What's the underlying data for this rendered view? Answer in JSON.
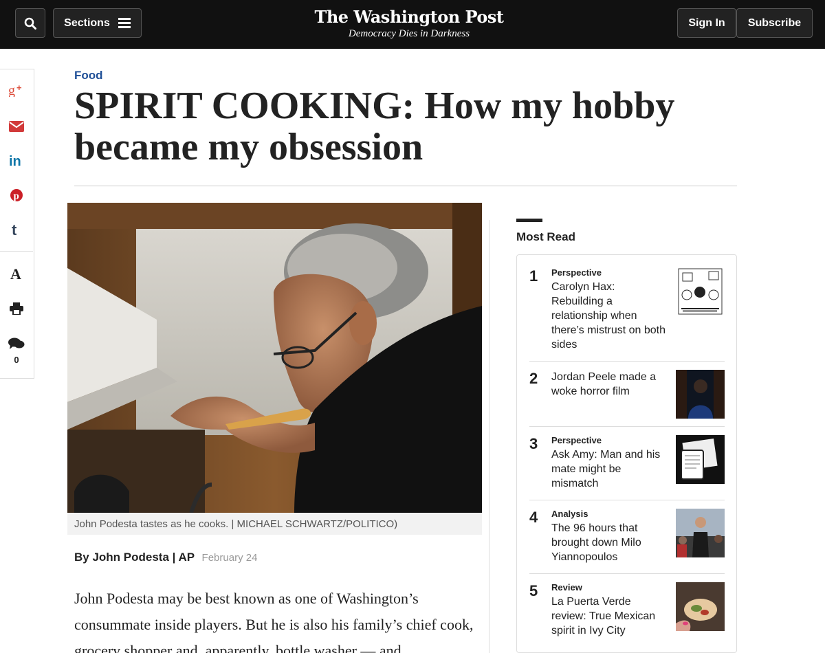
{
  "header": {
    "sections_label": "Sections",
    "logo_name": "The Washington Post",
    "logo_tagline": "Democracy Dies in Darkness",
    "signin_label": "Sign In",
    "subscribe_label": "Subscribe"
  },
  "share_rail": {
    "icons": [
      "google-plus-icon",
      "email-icon",
      "linkedin-icon",
      "pinterest-icon",
      "tumblr-icon",
      "text-size-icon",
      "print-icon",
      "comments-icon"
    ],
    "comment_count": "0",
    "colors": {
      "google_plus": "#dd4b39",
      "email": "#d23a3a",
      "linkedin": "#0e76a8",
      "pinterest": "#cb2027",
      "tumblr": "#35465c"
    }
  },
  "article": {
    "kicker": "Food",
    "headline": "SPIRIT COOKING: How my hobby became my obsession",
    "caption": "John Podesta tastes as he cooks. | MICHAEL SCHWARTZ/POLITICO)",
    "byline": "By John Podesta | AP",
    "date": "February 24",
    "body": "John Podesta may be best known as one of Washington’s consummate inside players. But he is also his family’s chief cook, grocery shopper and, apparently, bottle washer — and"
  },
  "most_read": {
    "title": "Most Read",
    "items": [
      {
        "num": "1",
        "label": "Perspective",
        "headline": "Carolyn Hax: Rebuilding a relationship when there’s mistrust on both sides"
      },
      {
        "num": "2",
        "label": "",
        "headline": "Jordan Peele made a woke horror film"
      },
      {
        "num": "3",
        "label": "Perspective",
        "headline": "Ask Amy: Man and his mate might be mismatch"
      },
      {
        "num": "4",
        "label": "Analysis",
        "headline": "The 96 hours that brought down Milo Yiannopoulos"
      },
      {
        "num": "5",
        "label": "Review",
        "headline": "La Puerta Verde review: True Mexican spirit in Ivy City"
      }
    ]
  },
  "colors": {
    "topbar": "#111111",
    "kicker": "#1f4f97"
  }
}
